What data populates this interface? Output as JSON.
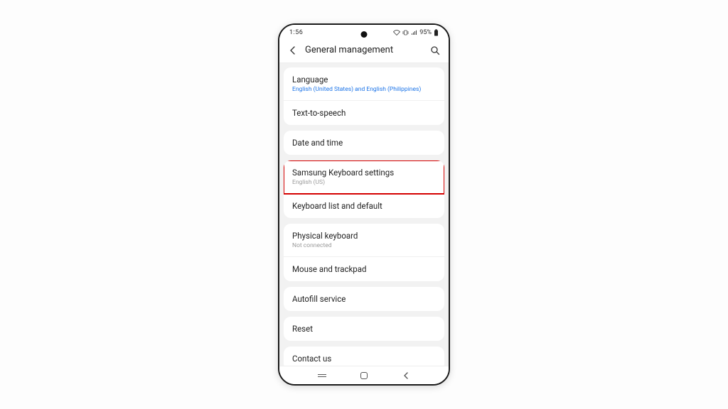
{
  "status": {
    "time": "1:56",
    "battery_pct": "95%"
  },
  "header": {
    "title": "General management"
  },
  "groups": [
    {
      "items": [
        {
          "label": "Language",
          "sub_blue": "English (United States) and English (Philippines)"
        },
        {
          "label": "Text-to-speech"
        }
      ]
    },
    {
      "items": [
        {
          "label": "Date and time"
        }
      ]
    },
    {
      "items": [
        {
          "label": "Samsung Keyboard settings",
          "sub_grey": "English (US)",
          "highlight": true
        },
        {
          "label": "Keyboard list and default"
        }
      ]
    },
    {
      "items": [
        {
          "label": "Physical keyboard",
          "sub_grey": "Not connected"
        },
        {
          "label": "Mouse and trackpad"
        }
      ]
    },
    {
      "items": [
        {
          "label": "Autofill service"
        }
      ]
    },
    {
      "items": [
        {
          "label": "Reset"
        }
      ]
    },
    {
      "items": [
        {
          "label": "Contact us"
        }
      ]
    }
  ]
}
